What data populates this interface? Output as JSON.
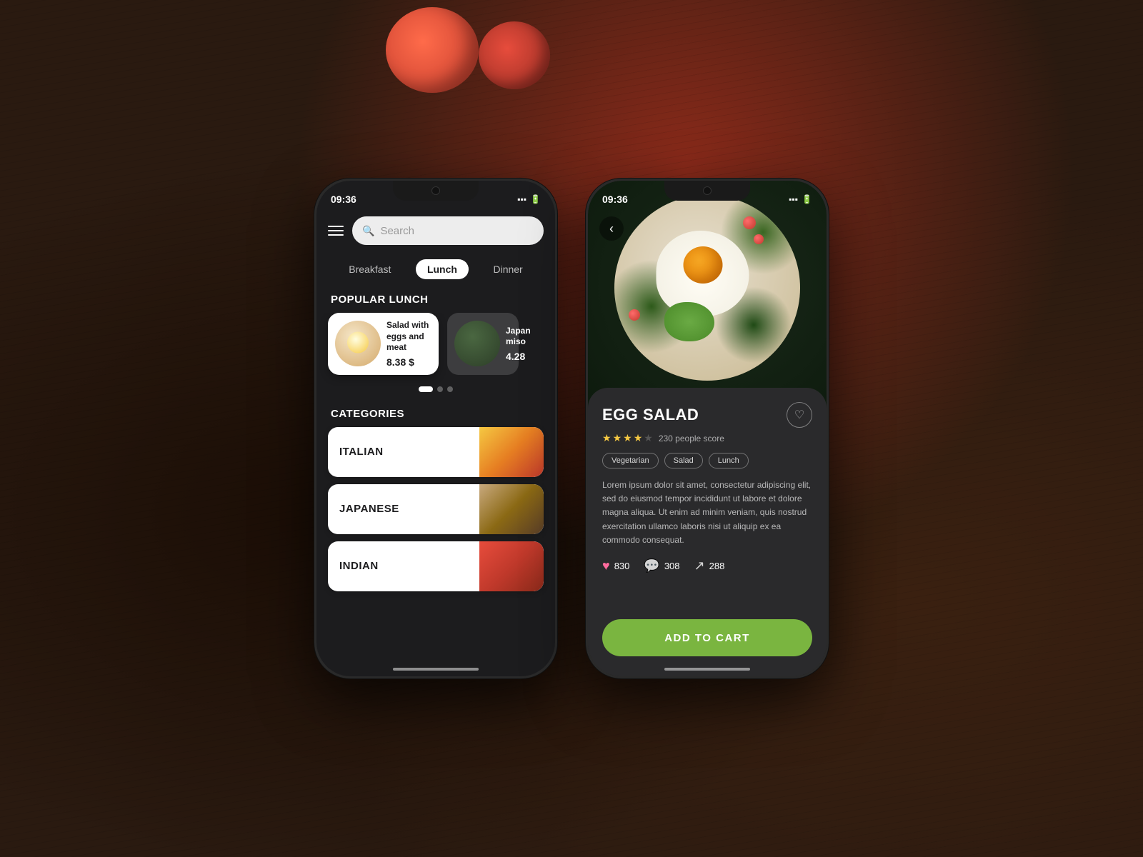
{
  "background": {
    "color": "#2a1a10"
  },
  "phone1": {
    "statusBar": {
      "time": "09:36"
    },
    "header": {
      "searchPlaceholder": "Search"
    },
    "mealTabs": {
      "tabs": [
        {
          "label": "Breakfast",
          "active": false
        },
        {
          "label": "Lunch",
          "active": true
        },
        {
          "label": "Dinner",
          "active": false
        }
      ]
    },
    "popularSection": {
      "title": "POPULAR LUNCH",
      "cards": [
        {
          "name": "Salad with eggs and meat",
          "price": "8.38 $"
        },
        {
          "name": "Japan miso",
          "price": "4.28"
        }
      ]
    },
    "categoriesSection": {
      "title": "CATEGORIES",
      "categories": [
        {
          "name": "ITALIAN"
        },
        {
          "name": "JAPANESE"
        },
        {
          "name": "INDIAN"
        }
      ]
    }
  },
  "phone2": {
    "statusBar": {
      "time": "09:36"
    },
    "detail": {
      "title": "EGG SALAD",
      "rating": {
        "value": 4,
        "maxValue": 5,
        "count": "230 people score"
      },
      "tags": [
        "Vegetarian",
        "Salad",
        "Lunch"
      ],
      "description": "Lorem ipsum dolor sit amet, consectetur adipiscing elit, sed do eiusmod tempor incididunt ut labore et dolore magna aliqua. Ut enim ad minim veniam, quis nostrud exercitation ullamco laboris nisi ut aliquip ex ea commodo consequat.",
      "likes": "830",
      "comments": "308",
      "shares": "288",
      "addToCartLabel": "ADD TO CART"
    }
  }
}
